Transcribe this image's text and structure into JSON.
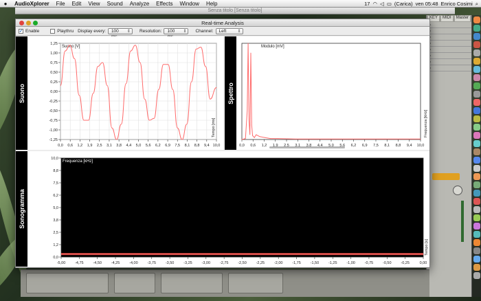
{
  "menubar": {
    "app": "AudioXplorer",
    "items": [
      "File",
      "Edit",
      "View",
      "Sound",
      "Analyze",
      "Effects",
      "Window",
      "Help"
    ],
    "status": {
      "badge": "17",
      "battery": "(Carica)",
      "clock": "ven 05:48",
      "user": "Enrico Cosimi"
    }
  },
  "background_window": {
    "title": "Senza titolo  [Senza titolo]"
  },
  "window": {
    "title": "Real-time Analysis",
    "toolbar": {
      "enable_label": "Enable",
      "enable_checked": true,
      "playthru_label": "Playthru",
      "playthru_checked": false,
      "display_every_label": "Display every:",
      "display_every_value": "100 ms",
      "resolution_label": "Resolution:",
      "resolution_value": "100 ms",
      "channel_label": "Channel:",
      "channel_value": "Left"
    },
    "panels": {
      "suono": "Suono",
      "spettro": "Spettro",
      "sonogramma": "Sonogramma"
    }
  },
  "daw": {
    "header": [
      "KEY",
      "MIDI",
      "Master"
    ],
    "rows": 8
  },
  "colors": {
    "trace": "#ff6b6b",
    "sonogram_bg": "#000000",
    "sonogram_line": "#c62828"
  },
  "chart_data": [
    {
      "type": "line",
      "ylabel": "Suono [V]",
      "xlabel": "Tempo [ms]",
      "xlim": [
        0,
        10
      ],
      "ylim": [
        -1.25,
        1.25
      ],
      "xticks": [
        "0,0",
        "0,6",
        "1,2",
        "1,9",
        "2,5",
        "3,1",
        "3,8",
        "4,4",
        "5,0",
        "5,6",
        "6,2",
        "6,9",
        "7,5",
        "8,1",
        "8,8",
        "9,4",
        "10,0"
      ],
      "yticks": [
        "1,25",
        "1,00",
        "0,75",
        "0,50",
        "0,25",
        "0,00",
        "-0,25",
        "-0,50",
        "-0,75",
        "-1,00",
        "-1,25"
      ],
      "series": [
        {
          "x": [
            0,
            0.3,
            0.6,
            0.9,
            1.2,
            1.5,
            1.8,
            2.1,
            2.4,
            2.7,
            3.0,
            3.3,
            3.6,
            3.9,
            4.2,
            4.5,
            4.8,
            5.1,
            5.4,
            5.7,
            6.0,
            6.3,
            6.6,
            6.9,
            7.2,
            7.5,
            7.8,
            8.1,
            8.4,
            8.7,
            9.0,
            9.3,
            9.6,
            10.0
          ],
          "y": [
            0.15,
            1.05,
            1.2,
            0.85,
            -0.1,
            -0.75,
            -0.75,
            -0.05,
            0.65,
            0.75,
            0.15,
            -0.95,
            -1.25,
            -0.85,
            0.2,
            1.05,
            1.2,
            0.75,
            -0.2,
            -0.75,
            -0.7,
            0.05,
            0.7,
            0.7,
            0.05,
            -0.95,
            -1.25,
            -0.85,
            0.25,
            1.1,
            1.15,
            0.65,
            -0.2,
            0.1
          ]
        }
      ]
    },
    {
      "type": "line",
      "ylabel": "Modulo [mV]",
      "xlabel": "Frequenza [kHz]",
      "xlim": [
        0,
        10
      ],
      "ylim": [
        0,
        1
      ],
      "xticks": [
        "0,0",
        "0,6",
        "1,2",
        "1,9",
        "2,5",
        "3,1",
        "3,8",
        "4,4",
        "5,0",
        "5,6",
        "6,2",
        "6,9",
        "7,5",
        "8,1",
        "8,8",
        "9,4",
        "10,0"
      ],
      "series": [
        {
          "x": [
            0,
            0.2,
            0.3,
            0.35,
            0.4,
            0.45,
            0.5,
            0.55,
            0.6,
            0.7,
            0.8,
            1.0,
            1.3,
            1.6,
            2.0,
            3.0,
            4.0,
            5.0,
            6.0,
            7.0,
            8.0,
            9.0,
            10.0
          ],
          "y": [
            0,
            0.01,
            0.3,
            1.0,
            0.2,
            0.05,
            0.9,
            0.15,
            0.04,
            0.02,
            0.05,
            0.03,
            0.02,
            0.01,
            0.01,
            0.005,
            0.005,
            0.005,
            0.005,
            0.005,
            0.005,
            0.005,
            0.005
          ]
        }
      ]
    },
    {
      "type": "heatmap",
      "ylabel": "Frequenza [kHz]",
      "xlabel": "Tempo [s]",
      "xlim": [
        -5,
        0
      ],
      "ylim": [
        0,
        10
      ],
      "xticks": [
        "-5,00",
        "-4,75",
        "-4,50",
        "-4,25",
        "-4,00",
        "-3,75",
        "-3,50",
        "-3,25",
        "-3,00",
        "-2,75",
        "-2,50",
        "-2,25",
        "-2,00",
        "-1,75",
        "-1,50",
        "-1,25",
        "-1,00",
        "-0,75",
        "-0,50",
        "-0,25",
        "0,00"
      ],
      "yticks": [
        "10,0",
        "8,8",
        "7,5",
        "6,2",
        "5,0",
        "3,8",
        "2,5",
        "1,2",
        "0,0"
      ],
      "bands": [
        {
          "freq_khz": 0.3,
          "intensity": "high"
        }
      ]
    }
  ]
}
